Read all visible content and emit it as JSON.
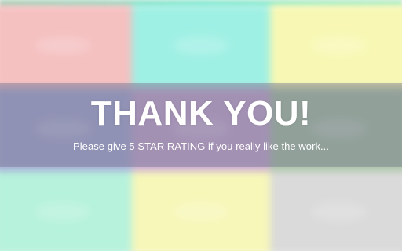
{
  "overlay": {
    "title": "THANK YOU!",
    "subtitle": "Please give 5 STAR RATING if you really like the work..."
  },
  "background": {
    "tile_colors": [
      "#f5c0c0",
      "#9ff0e4",
      "#f8f8b4",
      "#a7aad7",
      "#c9a8d6",
      "#a9c4a6",
      "#b6f2dc",
      "#f7f7b9",
      "#dadada"
    ]
  }
}
